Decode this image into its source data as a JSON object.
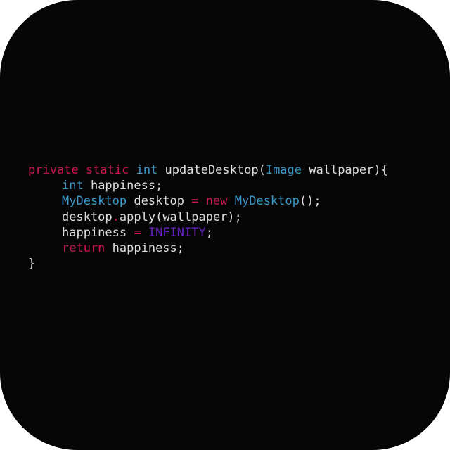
{
  "code": {
    "lines": [
      {
        "indent": false,
        "tokens": [
          {
            "text": "private",
            "kind": "keyword"
          },
          {
            "text": " ",
            "kind": "text"
          },
          {
            "text": "static",
            "kind": "keyword"
          },
          {
            "text": " ",
            "kind": "text"
          },
          {
            "text": "int",
            "kind": "type"
          },
          {
            "text": " updateDesktop(",
            "kind": "text"
          },
          {
            "text": "Image",
            "kind": "type"
          },
          {
            "text": " wallpaper){",
            "kind": "text"
          }
        ]
      },
      {
        "indent": true,
        "tokens": [
          {
            "text": "int",
            "kind": "type"
          },
          {
            "text": " happiness;",
            "kind": "text"
          }
        ]
      },
      {
        "indent": true,
        "tokens": [
          {
            "text": "MyDesktop",
            "kind": "type"
          },
          {
            "text": " desktop ",
            "kind": "text"
          },
          {
            "text": "=",
            "kind": "operator"
          },
          {
            "text": " ",
            "kind": "text"
          },
          {
            "text": "new",
            "kind": "keyword"
          },
          {
            "text": " ",
            "kind": "text"
          },
          {
            "text": "MyDesktop",
            "kind": "type"
          },
          {
            "text": "();",
            "kind": "text"
          }
        ]
      },
      {
        "indent": true,
        "tokens": [
          {
            "text": "desktop",
            "kind": "text"
          },
          {
            "text": ".",
            "kind": "operator"
          },
          {
            "text": "apply(wallpaper);",
            "kind": "text"
          }
        ]
      },
      {
        "indent": true,
        "tokens": [
          {
            "text": "happiness ",
            "kind": "text"
          },
          {
            "text": "=",
            "kind": "operator"
          },
          {
            "text": " ",
            "kind": "text"
          },
          {
            "text": "INFINITY",
            "kind": "constant"
          },
          {
            "text": ";",
            "kind": "text"
          }
        ]
      },
      {
        "indent": true,
        "tokens": [
          {
            "text": "return",
            "kind": "keyword"
          },
          {
            "text": " happiness;",
            "kind": "text"
          }
        ]
      },
      {
        "indent": false,
        "tokens": [
          {
            "text": "}",
            "kind": "text"
          }
        ]
      }
    ]
  },
  "colors": {
    "background": "#060505",
    "keyword": "#c9174f",
    "type": "#3a98c9",
    "operator": "#c9174f",
    "constant": "#6a22c7",
    "text": "#dedede"
  }
}
